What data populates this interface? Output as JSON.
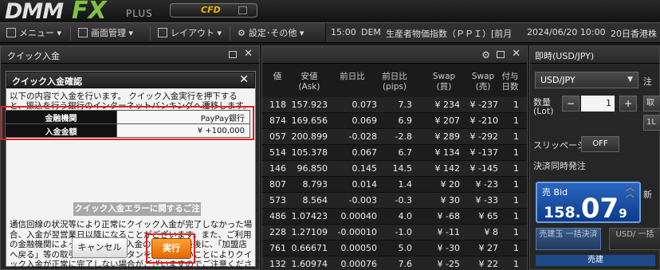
{
  "header": {
    "logo_dmm": "DMM",
    "logo_fx": "FX",
    "logo_plus": "PLUS",
    "cfd_label": "CFD"
  },
  "menubar": {
    "menu": "メニュー ▾",
    "screen": "画面管理 ▾",
    "layout": "レイアウト ▾",
    "settings": "設定･その他 ▾",
    "ticker_time": "15:00",
    "ticker_country": "DEM",
    "ticker_text": "生産者物価指数（ＰＰＩ）[前月",
    "ticker_date": "2024/06/20 10:00",
    "ticker_text2": "20日香港株"
  },
  "quick_panel": {
    "title": "クイック入金",
    "dialog_title": "クイック入金確認",
    "text1": "以下の内容で入金を行います。 クイック入金実行を押下すると、振込を行う銀行のインターネットバンキングへ遷移します。",
    "bank_label": "金融機関",
    "bank_value": "PayPay銀行",
    "amount_label": "入金金額",
    "amount_value": "¥ +100,000",
    "error_button": "クイック入金エラーに関するご注意",
    "text2": "通信回線の状況等により正常にクイック入金が完了しなかった場合、入金が翌営業日以降になることがございます。また、ご利用の金融機関によってはクイック入金の手続きの最後に、「加盟店へ戻る」等の取引画面へ戻るボタンを押下しないことによりクイック入金が正常に完了しない場合がございますのでご注意ください。",
    "cancel": "キャンセル",
    "execute": "実行"
  },
  "rates": {
    "columns": [
      {
        "l1": "値",
        "l2": ""
      },
      {
        "l1": "安値",
        "l2": "(Ask)"
      },
      {
        "l1": "前日比",
        "l2": ""
      },
      {
        "l1": "前日比",
        "l2": "(pips)"
      },
      {
        "l1": "Swap",
        "l2": "(買)"
      },
      {
        "l1": "Swap",
        "l2": "(売)"
      },
      {
        "l1": "付与",
        "l2": "日数"
      }
    ],
    "rows": [
      [
        "118",
        "157.923",
        "0.073",
        "7.3",
        "¥ 234",
        "¥ -237",
        "1"
      ],
      [
        "874",
        "169.656",
        "0.069",
        "6.9",
        "¥ 207",
        "¥ -210",
        "1"
      ],
      [
        "057",
        "200.899",
        "-0.028",
        "-2.8",
        "¥ 289",
        "¥ -292",
        "1"
      ],
      [
        "514",
        "105.378",
        "0.067",
        "6.7",
        "¥ 134",
        "¥ -137",
        "1"
      ],
      [
        "146",
        "96.850",
        "0.145",
        "14.5",
        "¥ 142",
        "¥ -145",
        "1"
      ],
      [
        "807",
        "8.793",
        "0.014",
        "1.4",
        "¥ 20",
        "¥ -23",
        "1"
      ],
      [
        "573",
        "8.564",
        "-0.003",
        "-0.3",
        "¥ 30",
        "¥ -33",
        "1"
      ],
      [
        "486",
        "1.07423",
        "0.00040",
        "4.0",
        "¥ -68",
        "¥ 65",
        "1"
      ],
      [
        "228",
        "1.27109",
        "-0.00010",
        "-1.0",
        "¥ -11",
        "¥ 8",
        "1"
      ],
      [
        "761",
        "0.66671",
        "0.00050",
        "5.0",
        "¥ -30",
        "¥ 27",
        "1"
      ],
      [
        "132",
        "1.60974",
        "0.00076",
        "7.6",
        "¥ -25",
        "¥ 22",
        "1"
      ]
    ]
  },
  "trade": {
    "title": "即時(USD/JPY)",
    "pair": "USD/JPY",
    "qty_label1": "数量",
    "qty_label2": "(Lot)",
    "qty_value": "1",
    "minus": "−",
    "plus": "+",
    "side1": "取",
    "side2": "1L",
    "side0": "注",
    "slippage": "スリッページ",
    "off": "OFF",
    "settle_order": "決済同時発注",
    "bid_label": "売 Bid",
    "bid_main": "158.",
    "bid_big": "07",
    "bid_small": "9",
    "new": "新",
    "settle_btn": "売建玉 一括決済",
    "settle_btn2": "USD/ 一括",
    "build": "売建"
  }
}
